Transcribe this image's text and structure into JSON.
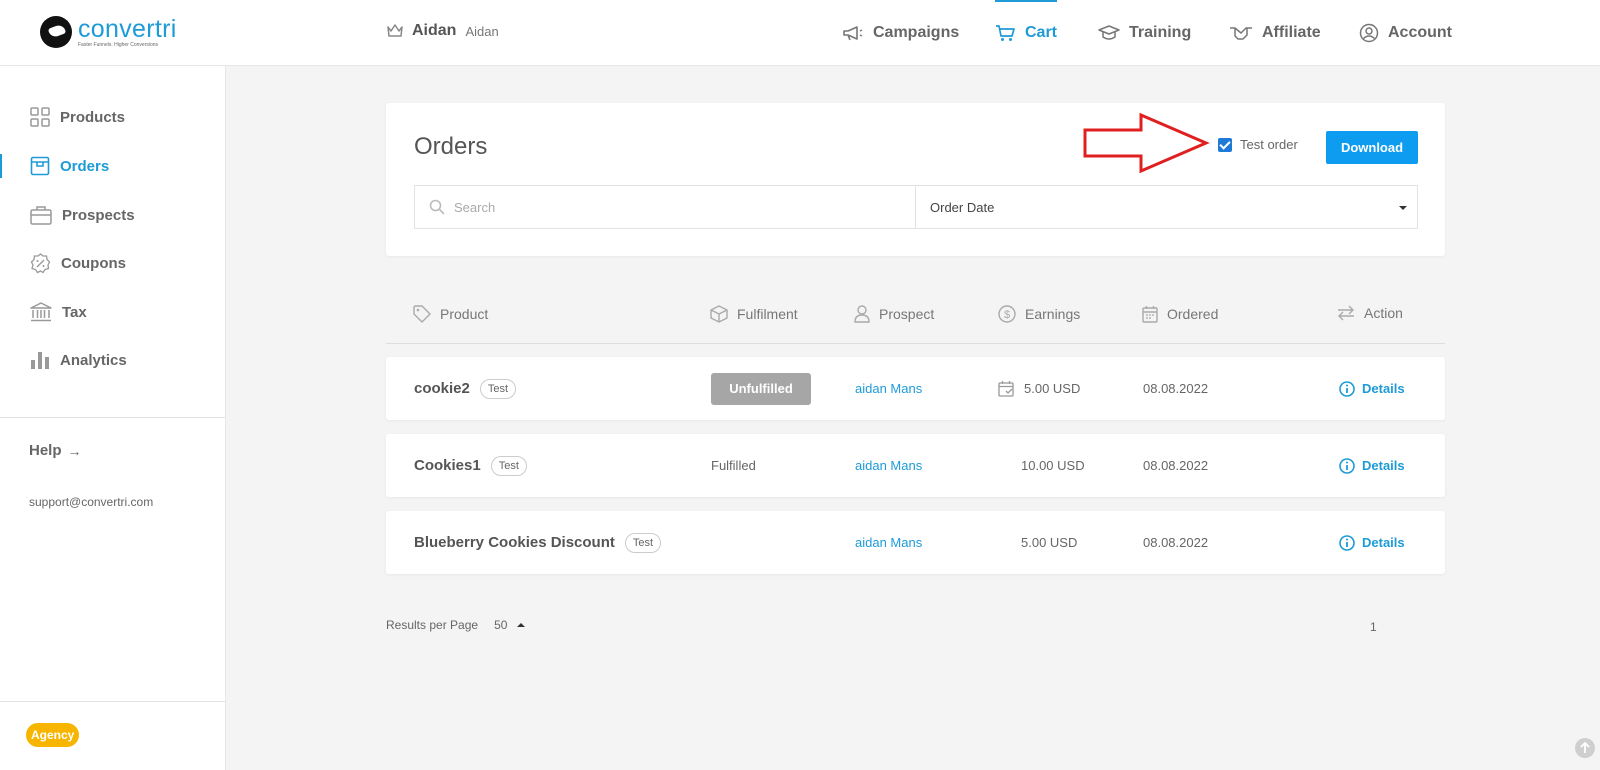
{
  "app": {
    "logo_name": "convertri",
    "logo_tagline": "Faster Funnels. Higher Conversions"
  },
  "user": {
    "name": "Aidan",
    "sub": "Aidan"
  },
  "nav": [
    {
      "label": "Campaigns",
      "icon": "megaphone-icon"
    },
    {
      "label": "Cart",
      "icon": "cart-icon",
      "active": true
    },
    {
      "label": "Training",
      "icon": "graduation-cap-icon"
    },
    {
      "label": "Affiliate",
      "icon": "handshake-icon"
    },
    {
      "label": "Account",
      "icon": "user-circle-icon"
    }
  ],
  "sidebar": {
    "items": [
      {
        "label": "Products",
        "icon": "grid-icon"
      },
      {
        "label": "Orders",
        "icon": "box-icon",
        "active": true
      },
      {
        "label": "Prospects",
        "icon": "briefcase-icon"
      },
      {
        "label": "Coupons",
        "icon": "percent-badge-icon"
      },
      {
        "label": "Tax",
        "icon": "bank-icon"
      },
      {
        "label": "Analytics",
        "icon": "bar-chart-icon"
      }
    ],
    "help": "Help",
    "support_email": "support@convertri.com",
    "badge": "Agency"
  },
  "orders": {
    "title": "Orders",
    "test_order_label": "Test order",
    "test_order_checked": true,
    "download_label": "Download",
    "search_placeholder": "Search",
    "sort_value": "Order Date"
  },
  "table": {
    "headers": {
      "product": "Product",
      "fulfilment": "Fulfilment",
      "prospect": "Prospect",
      "earnings": "Earnings",
      "ordered": "Ordered",
      "action": "Action"
    },
    "rows": [
      {
        "product": "cookie2",
        "tag": "Test",
        "fulfilment": "Unfulfilled",
        "prospect": "aidan Mans",
        "earnings": "5.00 USD",
        "ordered": "08.08.2022",
        "action": "Details"
      },
      {
        "product": "Cookies1",
        "tag": "Test",
        "fulfilment": "Fulfilled",
        "prospect": "aidan Mans",
        "earnings": "10.00 USD",
        "ordered": "08.08.2022",
        "action": "Details"
      },
      {
        "product": "Blueberry Cookies Discount",
        "tag": "Test",
        "fulfilment": "",
        "prospect": "aidan Mans",
        "earnings": "5.00 USD",
        "ordered": "08.08.2022",
        "action": "Details"
      }
    ]
  },
  "pagination": {
    "results_label": "Results per Page",
    "per_page": "50",
    "current_page": "1"
  },
  "colors": {
    "accent": "#1e9bd7",
    "download": "#0e9cf0",
    "badge": "#f7b500",
    "arrow": "#e02020"
  }
}
